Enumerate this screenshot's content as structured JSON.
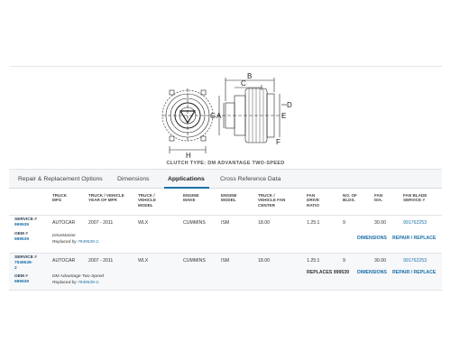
{
  "diagram": {
    "caption": "CLUTCH TYPE: DM ADVANTAGE TWO-SPEED",
    "dim_labels": [
      "B",
      "C",
      "G",
      "A",
      "E",
      "D",
      "F",
      "H"
    ]
  },
  "tabs": [
    {
      "label": "Repair & Replacement Options",
      "active": false
    },
    {
      "label": "Dimensions",
      "active": false
    },
    {
      "label": "Applications",
      "active": true
    },
    {
      "label": "Cross Reference Data",
      "active": false
    }
  ],
  "columns": [
    "TRUCK\nMFG",
    "TRUCK / VEHICLE\nYEAR OF MFR",
    "TRUCK /\nVEHICLE\nMODEL",
    "ENGINE\nMAKE",
    "ENGINE\nMODEL",
    "TRUCK /\nVEHICLE FAN\nCENTER",
    "FAN\nDRIVE\nRATIO",
    "NO. OF\nBLDS.",
    "FAN\nDIA.",
    "FAN BLADE\nSERVICE #"
  ],
  "rows": [
    {
      "service_label": "SERVICE #",
      "service_num": "999539",
      "oem_label": "OEM #",
      "oem_num": "989539",
      "cells": [
        "AUTOCAR",
        "2007 - 2011",
        "WLX",
        "CUMMINS",
        "ISM",
        "18.00",
        "1.25:1",
        "9",
        "30.00"
      ],
      "fan_blade": "991762253",
      "product": "DriveMaster",
      "replaced_prefix": "Replaced by ",
      "replaced_link": "7949539-2",
      "replaced_suffix": ".",
      "replaces": "",
      "dimensions": "DIMENSIONS",
      "repair": "REPAIR / REPLACE"
    },
    {
      "service_label": "SERVICE #",
      "service_num": "7949539-",
      "service_num2": "2",
      "oem_label": "OEM #",
      "oem_num": "989539",
      "cells": [
        "AUTOCAR",
        "2007 - 2011",
        "WLX",
        "CUMMINS",
        "ISM",
        "18.00",
        "1.25:1",
        "9",
        "30.00"
      ],
      "fan_blade": "991762253",
      "product": "DM Advantage Two-Speed",
      "replaced_prefix": "Replaced by ",
      "replaced_link": "7949539-2",
      "replaced_suffix": ".",
      "replaces": "REPLACES 999539",
      "dimensions": "DIMENSIONS",
      "repair": "REPAIR / REPLACE"
    }
  ]
}
